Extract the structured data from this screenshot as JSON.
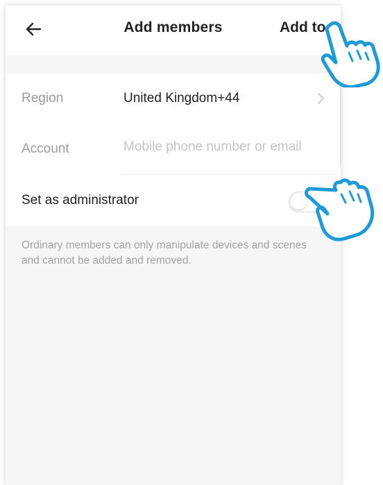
{
  "header": {
    "back_icon": "arrow-left-icon",
    "title": "Add members",
    "add_to_label": "Add to"
  },
  "form": {
    "region": {
      "label": "Region",
      "value": "United Kingdom+44",
      "icon": "chevron-right-icon"
    },
    "account": {
      "label": "Account",
      "value": "",
      "placeholder": "Mobile phone number or email"
    },
    "admin": {
      "label": "Set as administrator",
      "enabled": false
    }
  },
  "hint": "Ordinary members can only manipulate devices and scenes and cannot be added and removed.",
  "overlays": {
    "pointer_icon": "pointing-hand-icon",
    "pointer_color": "#1e9bd7"
  },
  "colors": {
    "page_background": "#f6f6f7",
    "card_background": "#ffffff",
    "primary_text": "#222222",
    "secondary_text": "#9b9b9b",
    "placeholder_text": "#c4c4c4"
  }
}
